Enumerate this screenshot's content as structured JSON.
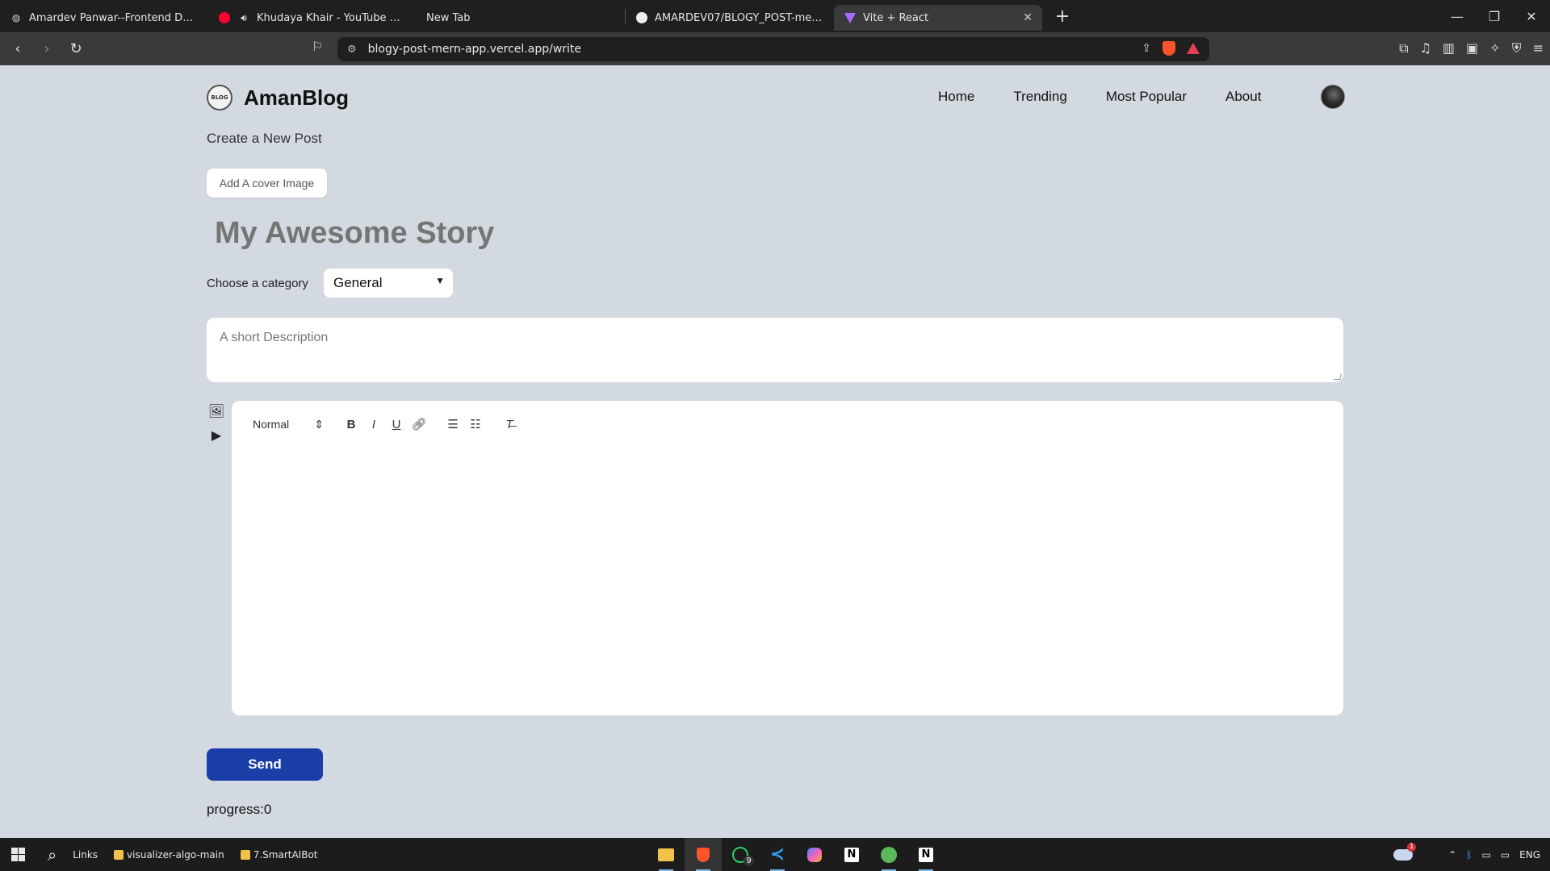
{
  "browser": {
    "tabs": [
      {
        "label": "Amardev Panwar--Frontend Developer",
        "icon": "globe-icon",
        "active": false
      },
      {
        "label": "Khudaya Khair - YouTube Music",
        "icon": "youtube-music-icon",
        "active": false
      },
      {
        "label": "New Tab",
        "icon": "",
        "active": false
      },
      {
        "label": "AMARDEV07/BLOGY_POST-mern-app",
        "icon": "github-icon",
        "active": false
      },
      {
        "label": "Vite + React",
        "icon": "vite-icon",
        "active": true
      }
    ],
    "url": "blogy-post-mern-app.vercel.app/write"
  },
  "site": {
    "brand": "AmanBlog",
    "logo_text": "BLOG",
    "nav": [
      {
        "label": "Home"
      },
      {
        "label": "Trending"
      },
      {
        "label": "Most Popular"
      },
      {
        "label": "About"
      }
    ]
  },
  "form": {
    "subtitle": "Create a New Post",
    "cover_button": "Add A cover Image",
    "title_placeholder": "My Awesome Story",
    "category_label": "Choose a category",
    "category_selected": "General",
    "description_placeholder": "A short Description",
    "editor_format": "Normal",
    "send_label": "Send",
    "progress_text": "progress:0"
  },
  "taskbar": {
    "links_label": "Links",
    "pinned_folders": [
      "visualizer-algo-main",
      "7.SmartAIBot"
    ],
    "whatsapp_badge": "9",
    "weather_badge": "1",
    "language": "ENG"
  },
  "colors": {
    "page_bg": "#d3d9e0",
    "send_button": "#1a3ea8"
  }
}
